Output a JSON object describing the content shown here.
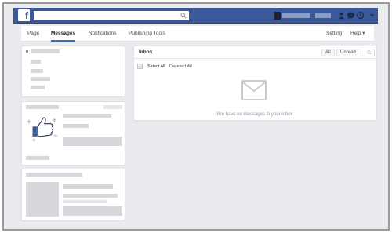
{
  "topbar": {
    "logo_letter": "f",
    "search": {
      "placeholder": ""
    }
  },
  "pagenav": {
    "items": [
      {
        "label": "Page"
      },
      {
        "label": "Messages"
      },
      {
        "label": "Notifications"
      },
      {
        "label": "Publishing Tools"
      }
    ],
    "setting_label": "Setting",
    "help_label": "Help ▾"
  },
  "inbox": {
    "title": "Inbox",
    "filter_all": "All",
    "filter_unread": "Unread",
    "select_all": "Select All",
    "deselect_all": "Deselect All",
    "empty_message": "You have no messages in your inbox."
  },
  "colors": {
    "brand_blue": "#3b5998",
    "page_bg": "#e9ebee",
    "placeholder_gray": "#d6d8dc",
    "thumb_blue": "#3b5998"
  },
  "icons": [
    "search-icon",
    "friends-icon",
    "messages-icon",
    "notifications-icon",
    "dropdown-arrow-icon",
    "thumbs-up-icon",
    "envelope-icon"
  ]
}
